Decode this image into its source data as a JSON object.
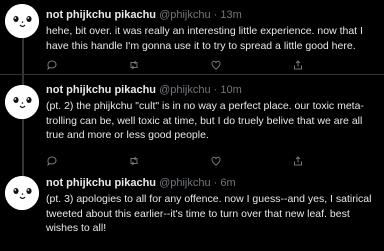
{
  "tweets": [
    {
      "name": "not phijkchu pikachu",
      "handle": "@phijkchu",
      "sep": "·",
      "time": "13m",
      "text": "hehe, bit over. it was really an interesting little experience. now that I have this handle I'm gonna use it to try to spread a little good here."
    },
    {
      "name": "not phijkchu pikachu",
      "handle": "@phijkchu",
      "sep": "·",
      "time": "10m",
      "text": "(pt. 2) the phijkchu \"cult\" is in no way a perfect place. our toxic meta-trolling can be, well toxic at time, but I do truely belive that we are all true and more or less good people."
    },
    {
      "name": "not phijkchu pikachu",
      "handle": "@phijkchu",
      "sep": "·",
      "time": "6m",
      "text": "(pt. 3) apologies to all for any offence. now I guess--and yes, I satirical tweeted about this earlier--it's time to turn over that new leaf. best wishes to all!"
    }
  ],
  "colors": {
    "background": "#000000",
    "text": "#e7e9ea",
    "secondary": "#71767b",
    "divider": "#2f3336"
  },
  "icons": [
    "avatar-pikachu",
    "reply-icon",
    "retweet-icon",
    "like-icon",
    "share-icon"
  ]
}
